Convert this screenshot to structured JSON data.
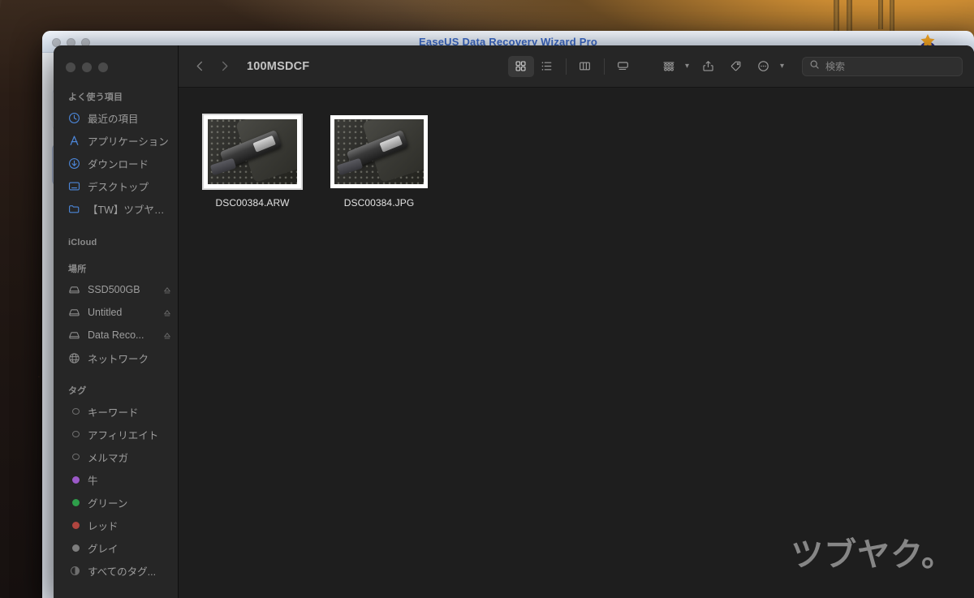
{
  "desktop": {
    "background_window": {
      "title": "EaseUS Data Recovery Wizard  Pro",
      "mascot_icon": "easeus-mascot-icon"
    },
    "watermark": "ツブヤク。"
  },
  "finder": {
    "window_controls": [
      "close",
      "minimize",
      "zoom"
    ],
    "toolbar": {
      "back_icon": "‹",
      "forward_icon": "›",
      "path_title": "100MSDCF",
      "view_buttons": [
        {
          "name": "icon-view",
          "active": true
        },
        {
          "name": "list-view",
          "active": false
        },
        {
          "name": "column-view",
          "active": false
        },
        {
          "name": "gallery-view",
          "active": false
        }
      ],
      "group_label": "group-items-icon",
      "share_label": "share-icon",
      "tag_label": "tag-icon",
      "more_label": "more-actions-icon",
      "search_placeholder": "検索"
    },
    "sidebar": {
      "sections": [
        {
          "title": "よく使う項目",
          "items": [
            {
              "label": "最近の項目",
              "icon": "clock-icon"
            },
            {
              "label": "アプリケーション",
              "icon": "applications-icon"
            },
            {
              "label": "ダウンロード",
              "icon": "downloads-icon"
            },
            {
              "label": "デスクトップ",
              "icon": "desktop-icon"
            },
            {
              "label": "【TW】ツブヤク。",
              "icon": "folder-icon"
            }
          ]
        },
        {
          "title": "iCloud",
          "items": []
        },
        {
          "title": "場所",
          "items": [
            {
              "label": "SSD500GB",
              "icon": "drive-icon",
              "eject": true
            },
            {
              "label": "Untitled",
              "icon": "drive-icon",
              "eject": true
            },
            {
              "label": "Data Reco...",
              "icon": "drive-icon",
              "eject": true
            },
            {
              "label": "ネットワーク",
              "icon": "network-icon",
              "eject": false
            }
          ]
        },
        {
          "title": "タグ",
          "items": [
            {
              "label": "キーワード",
              "color": "hollow"
            },
            {
              "label": "アフィリエイト",
              "color": "hollow"
            },
            {
              "label": "メルマガ",
              "color": "hollow"
            },
            {
              "label": "牛",
              "color": "#9b59c8"
            },
            {
              "label": "グリーン",
              "color": "#2e9e4a"
            },
            {
              "label": "レッド",
              "color": "#b0453f"
            },
            {
              "label": "グレイ",
              "color": "#7d7d7d"
            },
            {
              "label": "すべてのタグ...",
              "color": "alltags"
            }
          ]
        }
      ]
    },
    "files": [
      {
        "name": "DSC00384.ARW",
        "selected": true,
        "thumbnail": "photo-usb-flash-drive"
      },
      {
        "name": "DSC00384.JPG",
        "selected": false,
        "thumbnail": "photo-usb-flash-drive"
      }
    ]
  }
}
